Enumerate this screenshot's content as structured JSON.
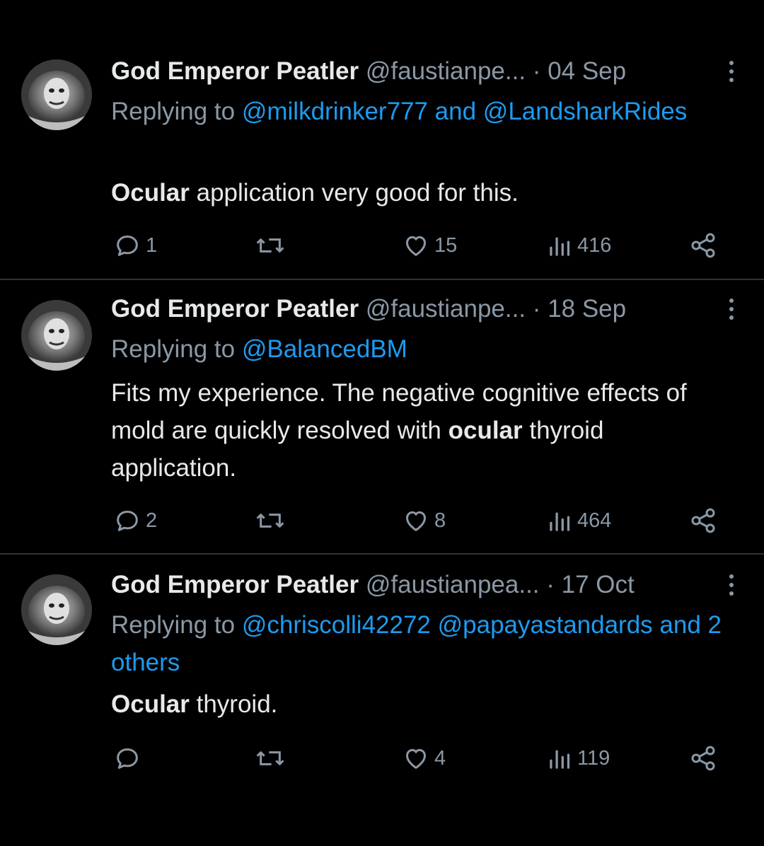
{
  "tweets": [
    {
      "display_name": "God Emperor Peatler",
      "handle": "@faustianpe...",
      "separator": "·",
      "date": "04 Sep",
      "replying_prefix": "Replying to",
      "reply_mentions": "@milkdrinker777 and @LandsharkRides",
      "body_bold": "Ocular",
      "body_rest": " application very good for this.",
      "reply_count": "1",
      "retweet_count": "",
      "like_count": "15",
      "view_count": "416"
    },
    {
      "display_name": "God Emperor Peatler",
      "handle": "@faustianpe...",
      "separator": "·",
      "date": "18 Sep",
      "replying_prefix": "Replying to",
      "reply_mentions": "@BalancedBM",
      "body_pre": "Fits my experience. The negative cognitive effects of mold are quickly resolved with ",
      "body_bold": "ocular",
      "body_post": " thyroid application.",
      "reply_count": "2",
      "retweet_count": "",
      "like_count": "8",
      "view_count": "464"
    },
    {
      "display_name": "God Emperor Peatler",
      "handle": "@faustianpea...",
      "separator": "·",
      "date": "17 Oct",
      "replying_prefix": "Replying to",
      "reply_mentions": "@chriscolli42272 @papayastandards and 2 others",
      "body_bold": "Ocular",
      "body_rest": " thyroid.",
      "reply_count": "",
      "retweet_count": "",
      "like_count": "4",
      "view_count": "119"
    }
  ],
  "icons": {
    "reply": "reply-icon",
    "retweet": "retweet-icon",
    "like": "heart-icon",
    "views": "views-icon",
    "share": "share-icon",
    "more": "more-options-icon"
  },
  "colors": {
    "background": "#000000",
    "text": "#e7e9ea",
    "muted": "#8b98a5",
    "accent": "#1d9bf0",
    "divider": "#2f3336"
  }
}
